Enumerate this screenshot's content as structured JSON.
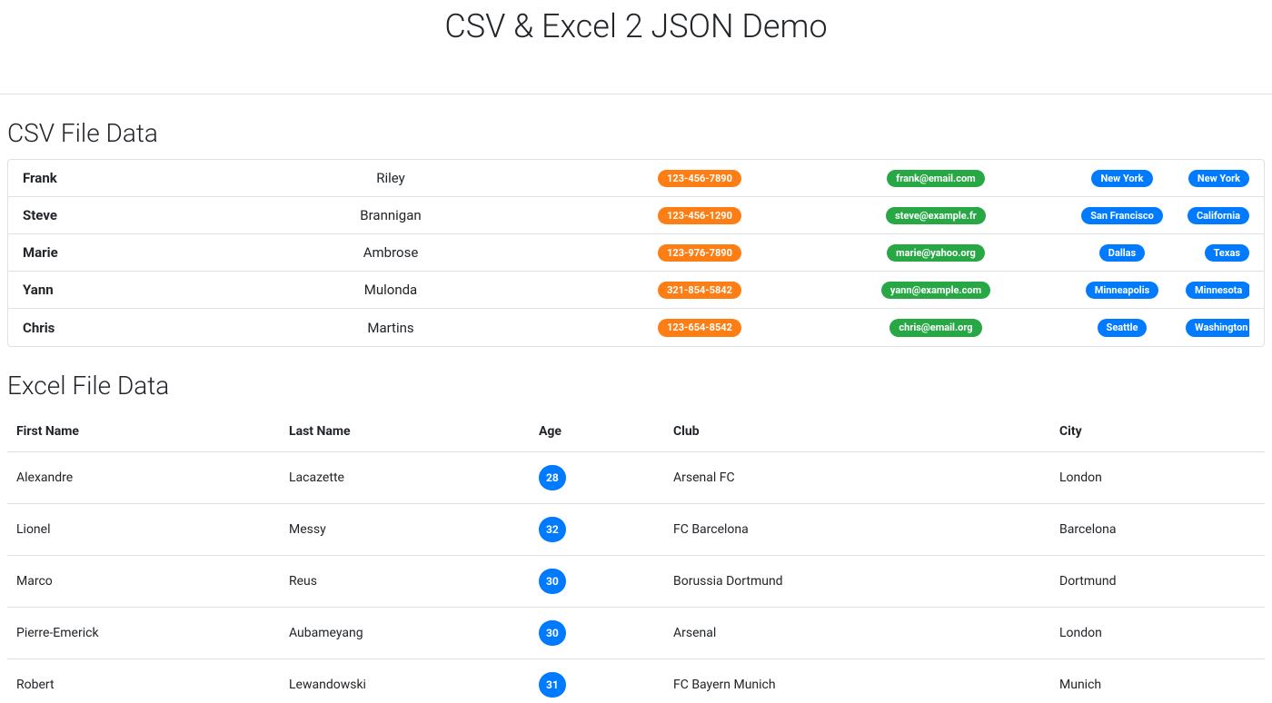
{
  "hero": {
    "title": "CSV & Excel 2 JSON Demo"
  },
  "csv": {
    "heading": "CSV File Data",
    "rows": [
      {
        "first": "Frank",
        "last": "Riley",
        "phone": "123-456-7890",
        "email": "frank@email.com",
        "city": "New York",
        "state": "New York"
      },
      {
        "first": "Steve",
        "last": "Brannigan",
        "phone": "123-456-1290",
        "email": "steve@example.fr",
        "city": "San Francisco",
        "state": "California"
      },
      {
        "first": "Marie",
        "last": "Ambrose",
        "phone": "123-976-7890",
        "email": "marie@yahoo.org",
        "city": "Dallas",
        "state": "Texas"
      },
      {
        "first": "Yann",
        "last": "Mulonda",
        "phone": "321-854-5842",
        "email": "yann@example.com",
        "city": "Minneapolis",
        "state": "Minnesota"
      },
      {
        "first": "Chris",
        "last": "Martins",
        "phone": "123-654-8542",
        "email": "chris@email.org",
        "city": "Seattle",
        "state": "Washington"
      }
    ]
  },
  "excel": {
    "heading": "Excel File Data",
    "headers": {
      "first": "First Name",
      "last": "Last Name",
      "age": "Age",
      "club": "Club",
      "city": "City"
    },
    "rows": [
      {
        "first": "Alexandre",
        "last": "Lacazette",
        "age": "28",
        "club": "Arsenal FC",
        "city": "London"
      },
      {
        "first": "Lionel",
        "last": "Messy",
        "age": "32",
        "club": "FC Barcelona",
        "city": "Barcelona"
      },
      {
        "first": "Marco",
        "last": "Reus",
        "age": "30",
        "club": "Borussia Dortmund",
        "city": "Dortmund"
      },
      {
        "first": "Pierre-Emerick",
        "last": "Aubameyang",
        "age": "30",
        "club": "Arsenal",
        "city": "London"
      },
      {
        "first": "Robert",
        "last": "Lewandowski",
        "age": "31",
        "club": "FC Bayern Munich",
        "city": "Munich"
      }
    ]
  },
  "colors": {
    "orange": "#fd7e14",
    "green": "#28a745",
    "blue": "#007bff"
  }
}
